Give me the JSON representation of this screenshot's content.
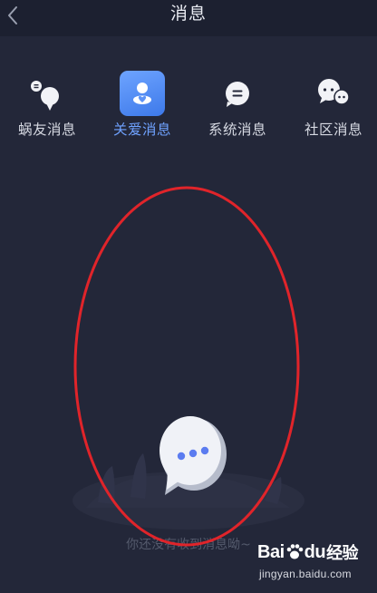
{
  "header": {
    "title": "消息"
  },
  "tabs": [
    {
      "id": "friend",
      "label": "蜗友消息",
      "icon": "friend-chat-icon",
      "active": false
    },
    {
      "id": "care",
      "label": "关爱消息",
      "icon": "care-heart-icon",
      "active": true
    },
    {
      "id": "system",
      "label": "系统消息",
      "icon": "system-message-icon",
      "active": false
    },
    {
      "id": "community",
      "label": "社区消息",
      "icon": "community-chat-icon",
      "active": false
    }
  ],
  "empty_state": {
    "text": "你还没有收到消息呦~",
    "illustration": "chat-bubble-illustration"
  },
  "colors": {
    "background": "#232739",
    "topbar": "#1c2030",
    "accent": "#6fa2ff",
    "annotation": "#e0242a"
  },
  "watermark": {
    "brand": "Bai",
    "brand_mid": "du",
    "brand_cn": "经验",
    "url": "jingyan.baidu.com"
  }
}
